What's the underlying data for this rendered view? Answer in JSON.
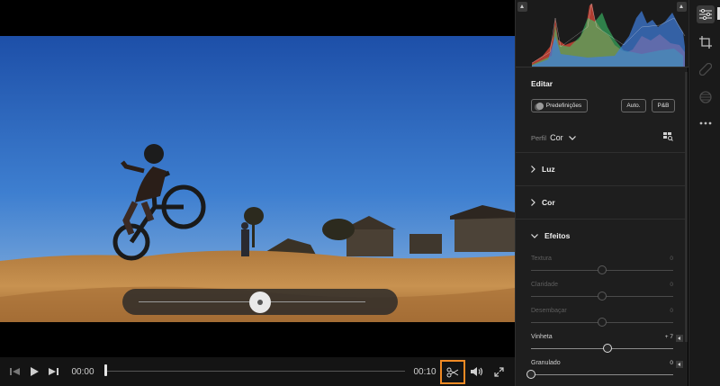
{
  "player": {
    "time_current": "00:00",
    "time_end": "00:10",
    "playback_progress": 0.0,
    "trim_handle_position": 0.5
  },
  "panel": {
    "title": "Editar",
    "presets_label": "Predefinições",
    "auto_label": "Auto.",
    "bw_label": "P&B",
    "profile": {
      "label": "Perfil",
      "value": "Cor"
    },
    "sections": {
      "light": "Luz",
      "color": "Cor",
      "effects": "Efeitos"
    },
    "sliders": [
      {
        "label": "Textura",
        "value": "0",
        "level": 0.5,
        "active": false
      },
      {
        "label": "Claridade",
        "value": "0",
        "level": 0.5,
        "active": false
      },
      {
        "label": "Desembaçar",
        "value": "0",
        "level": 0.5,
        "active": false
      },
      {
        "label": "Vinheta",
        "value": "+ 7",
        "level": 0.535,
        "active": true
      },
      {
        "label": "Granulado",
        "value": "0",
        "level": 0.0,
        "active": true
      }
    ]
  },
  "rail": {
    "tools": [
      "sliders-icon",
      "crop-icon",
      "healing-icon",
      "masking-icon",
      "more-icon"
    ]
  },
  "colors": {
    "accent_orange": "#f08a24",
    "histogram_red": "#e04a3a",
    "histogram_green": "#3ec46a",
    "histogram_blue": "#3f7fe0"
  }
}
